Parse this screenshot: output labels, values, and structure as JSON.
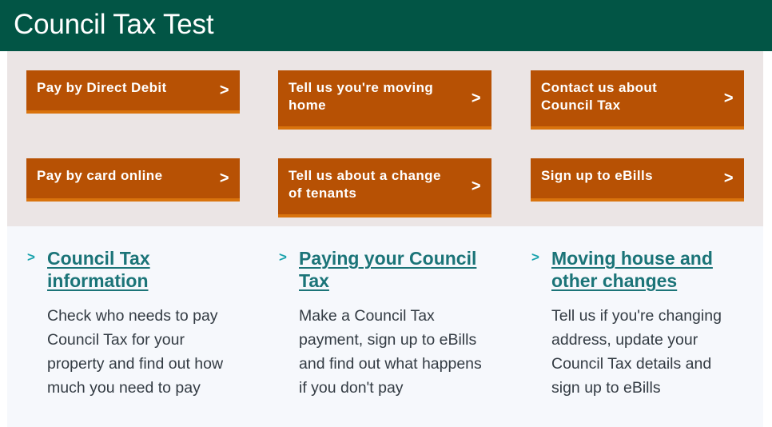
{
  "header": {
    "title": "Council Tax Test"
  },
  "colors": {
    "header_bg": "#025545",
    "button_bg": "#b75104",
    "button_border": "#d9730d",
    "link": "#1b7478",
    "chevron": "#1aa3ad"
  },
  "buttons": [
    {
      "label": "Pay by Direct Debit",
      "icon": "chevron-right-icon",
      "glyph": ">"
    },
    {
      "label": "Tell us you're moving home",
      "icon": "chevron-right-icon",
      "glyph": ">"
    },
    {
      "label": "Contact us about Council Tax",
      "icon": "chevron-right-icon",
      "glyph": ">"
    },
    {
      "label": "Pay by card online",
      "icon": "chevron-right-icon",
      "glyph": ">"
    },
    {
      "label": "Tell us about a change of tenants",
      "icon": "chevron-right-icon",
      "glyph": ">"
    },
    {
      "label": "Sign up to eBills",
      "icon": "chevron-right-icon",
      "glyph": ">"
    }
  ],
  "sections": [
    {
      "title": "Council Tax information",
      "glyph": ">",
      "description": "Check who needs to pay Council Tax for your property and find out how much you need to pay"
    },
    {
      "title": "Paying your Council Tax",
      "glyph": ">",
      "description": "Make a Council Tax payment, sign up to eBills and find out what happens if you don't pay"
    },
    {
      "title": "Moving house and other changes",
      "glyph": ">",
      "description": "Tell us if you're changing address, update your Council Tax details and sign up to eBills"
    }
  ]
}
